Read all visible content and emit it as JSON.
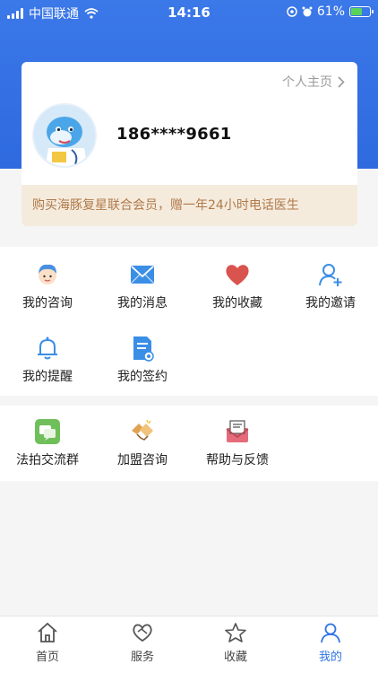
{
  "status_bar": {
    "carrier": "中国联通",
    "time": "14:16",
    "battery": "61%",
    "battery_level": 0.61,
    "accent": "#59d35a"
  },
  "profile": {
    "homepage_link": "个人主页",
    "phone": "186****9661"
  },
  "promo": {
    "text": "购买海豚复星联合会员，赠一年24小时电话医生"
  },
  "menu_group1": [
    {
      "label": "我的咨询",
      "icon": "consult-icon"
    },
    {
      "label": "我的消息",
      "icon": "message-icon"
    },
    {
      "label": "我的收藏",
      "icon": "heart-icon"
    },
    {
      "label": "我的邀请",
      "icon": "invite-icon"
    },
    {
      "label": "我的提醒",
      "icon": "bell-icon"
    },
    {
      "label": "我的签约",
      "icon": "contract-icon"
    }
  ],
  "menu_group2": [
    {
      "label": "法拍交流群",
      "icon": "chat-group-icon"
    },
    {
      "label": "加盟咨询",
      "icon": "handshake-icon"
    },
    {
      "label": "帮助与反馈",
      "icon": "mail-icon"
    }
  ],
  "tab_bar": {
    "tabs": [
      {
        "label": "首页",
        "icon": "home-icon"
      },
      {
        "label": "服务",
        "icon": "service-icon"
      },
      {
        "label": "收藏",
        "icon": "star-icon"
      },
      {
        "label": "我的",
        "icon": "user-icon"
      }
    ],
    "active_color": "#2f74e6"
  }
}
